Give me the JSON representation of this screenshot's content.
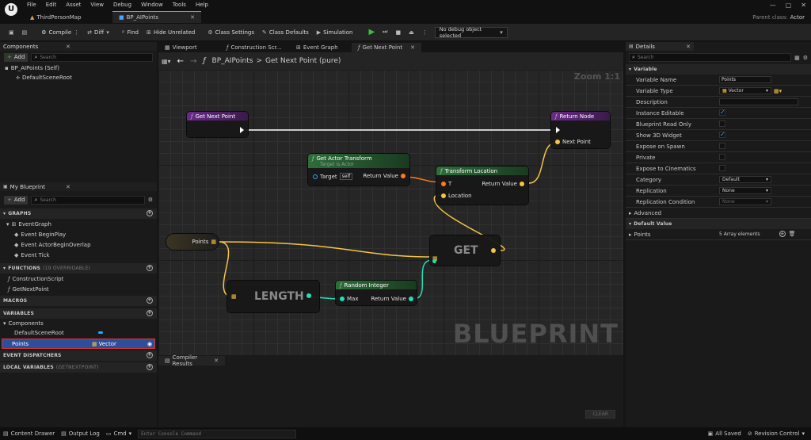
{
  "menu": {
    "items": [
      "File",
      "Edit",
      "Asset",
      "View",
      "Debug",
      "Window",
      "Tools",
      "Help"
    ]
  },
  "doc_tabs": [
    {
      "label": "ThirdPersonMap"
    },
    {
      "label": "BP_AIPoints"
    }
  ],
  "parent_class": {
    "label": "Parent class:",
    "value": "Actor"
  },
  "toolbar": {
    "compile": "Compile",
    "diff": "Diff",
    "find": "Find",
    "hide_unrelated": "Hide Unrelated",
    "class_settings": "Class Settings",
    "class_defaults": "Class Defaults",
    "simulation": "Simulation",
    "debug_object": "No debug object selected"
  },
  "components": {
    "title": "Components",
    "add": "Add",
    "search_placeholder": "Search",
    "root": "BP_AIPoints (Self)",
    "child": "DefaultSceneRoot"
  },
  "my_blueprint": {
    "title": "My Blueprint",
    "add": "Add",
    "search_placeholder": "Search",
    "graphs": "GRAPHS",
    "event_graph": "EventGraph",
    "events": [
      "Event BeginPlay",
      "Event ActorBeginOverlap",
      "Event Tick"
    ],
    "functions": "FUNCTIONS",
    "functions_note": "(19 OVERRIDABLE)",
    "function_items": [
      "ConstructionScript",
      "GetNextPoint"
    ],
    "macros": "MACROS",
    "variables": "VARIABLES",
    "components_group": "Components",
    "default_scene_root": "DefaultSceneRoot",
    "points_var": "Points",
    "points_type": "Vector",
    "event_dispatchers": "EVENT DISPATCHERS",
    "local_variables": "LOCAL VARIABLES",
    "local_note": "(GETNEXTPOINT)"
  },
  "graph_tabs": [
    "Viewport",
    "Construction Scr...",
    "Event Graph",
    "Get Next Point"
  ],
  "breadcrumb": {
    "root": "BP_AIPoints",
    "sep": ">",
    "leaf": "Get Next Point (pure)"
  },
  "zoom": "Zoom 1:1",
  "watermark": "BLUEPRINT",
  "nodes": {
    "entry": "Get Next Point",
    "return_node": "Return Node",
    "next_point": "Next Point",
    "get_actor_transform": "Get Actor Transform",
    "target_is_actor": "Target is Actor",
    "target": "Target",
    "self": "self",
    "return_value": "Return Value",
    "transform_location": "Transform Location",
    "t": "T",
    "location": "Location",
    "points": "Points",
    "get": "GET",
    "length": "LENGTH",
    "random_integer": "Random Integer",
    "max": "Max"
  },
  "compiler": {
    "tab": "Compiler Results",
    "clear": "CLEAR"
  },
  "details": {
    "title": "Details",
    "search_placeholder": "Search",
    "variable_section": "Variable",
    "rows": [
      {
        "label": "Variable Name",
        "value": "Points"
      },
      {
        "label": "Variable Type",
        "value": "Vector"
      },
      {
        "label": "Description",
        "value": ""
      },
      {
        "label": "Instance Editable",
        "value": ""
      },
      {
        "label": "Blueprint Read Only",
        "value": ""
      },
      {
        "label": "Show 3D Widget",
        "value": ""
      },
      {
        "label": "Expose on Spawn",
        "value": ""
      },
      {
        "label": "Private",
        "value": ""
      },
      {
        "label": "Expose to Cinematics",
        "value": ""
      },
      {
        "label": "Category",
        "value": "Default"
      },
      {
        "label": "Replication",
        "value": "None"
      },
      {
        "label": "Replication Condition",
        "value": "None"
      }
    ],
    "advanced": "Advanced",
    "default_value_section": "Default Value",
    "points": "Points",
    "array_elements": "5 Array elements"
  },
  "status": {
    "content_drawer": "Content Drawer",
    "output_log": "Output Log",
    "cmd": "Cmd",
    "console_placeholder": "Enter Console Command",
    "all_saved": "All Saved",
    "revision_control": "Revision Control"
  },
  "colors": {
    "vector_pin": "#f5c542",
    "exec_pin": "#ffffff",
    "int_pin": "#1fe0b4",
    "transform_pin": "#ff7a1a",
    "function_head": "#6a2a8a",
    "pure_head": "#2d6e3a",
    "selection": "#2b4f9a"
  }
}
